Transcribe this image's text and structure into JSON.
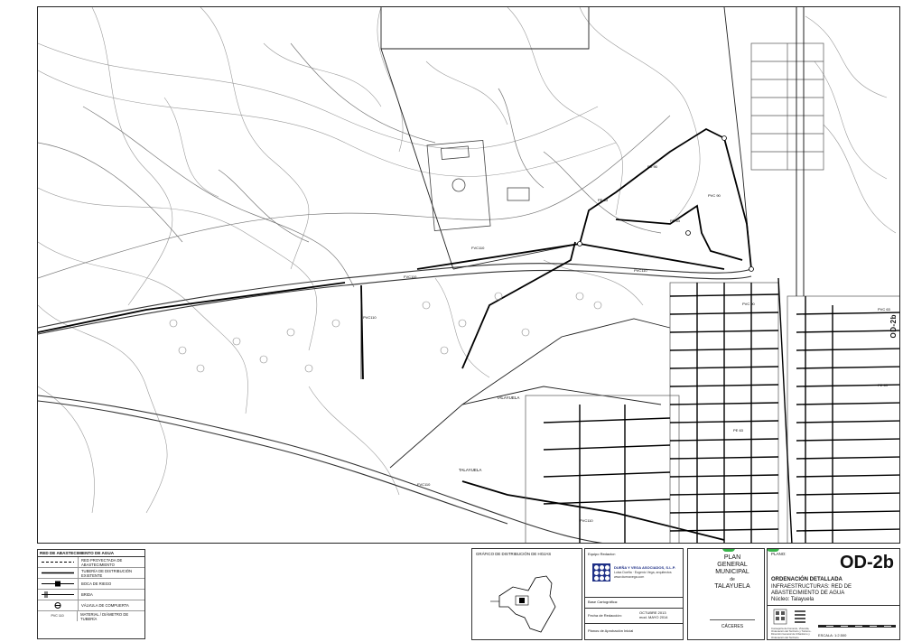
{
  "map": {
    "edge_label": "OD-2b",
    "pipe_labels": [
      "FVC110",
      "FVC110",
      "PVC110",
      "FD 90",
      "PE 63",
      "PVC 90",
      "PE 63",
      "PVC110",
      "PVC 63",
      "FVC110",
      "PVC110",
      "PE 63",
      "PVC 90",
      "PE 63"
    ],
    "place_labels": [
      "TALAYUELA",
      "TALAYUELA"
    ]
  },
  "legend": {
    "title": "RED DE ABASTECIMIENTO DE AGUA",
    "items": [
      {
        "label": "RED PROYECTADA DE ABASTECIMIENTO",
        "symbol": "dashed-line-icon"
      },
      {
        "label": "TUBERÍA DE DISTRIBUCIÓN EXISTENTE",
        "symbol": "solid-line-icon"
      },
      {
        "label": "BOCA DE RIEGO",
        "symbol": "boca-riego-icon"
      },
      {
        "label": "BRIDA",
        "symbol": "brida-icon"
      },
      {
        "label": "VÁLVULA DE COMPUERTA",
        "symbol": "valve-icon"
      },
      {
        "label": "MATERIAL / DIÁMETRO DE TUBERÍA",
        "symbol": "pipe-label-icon",
        "sample": "PVC 110"
      }
    ]
  },
  "distribution": {
    "title": "GRÁFICO DE DISTRIBUCIÓN DE HOJAS"
  },
  "team": {
    "title": "Equipo Redactor:",
    "firm_name": "DUEÑA Y VEGA ASOCIADOS, S.L.P.",
    "firm_sub1": "Luisa Dueña · Eugenio Vega, arquitectos",
    "firm_sub2": "www.duenavega.com",
    "base_label": "Base Cartográfica:",
    "fecha_label": "Fecha de Redacción:",
    "fecha_value1": "OCTUBRE 2013",
    "fecha_value2": "mod. MAYO 2014",
    "planos_label": "Planos de Aprobación Inicial"
  },
  "plan": {
    "line1": "PLAN",
    "line2": "GENERAL",
    "line3": "MUNICIPAL",
    "line4": "de",
    "line5": "TALAYUELA",
    "city": "CÁCERES"
  },
  "title_block": {
    "plano_label": "PLANO:",
    "code": "OD-2b",
    "heading": "ORDENACIÓN DETALLADA",
    "subtitle": "INFRAESTRUCTURAS: RED DE ABASTECIMIENTO DE AGUA",
    "nucleo": "Núcleo: Talayuela",
    "escala": "ESCALA:   1:2.500",
    "organization": "Consejería de Fomento, Vivienda, Ordenación del Territorio y Turismo · Dirección General de Urbanismo y Ordenación del Territorio"
  }
}
